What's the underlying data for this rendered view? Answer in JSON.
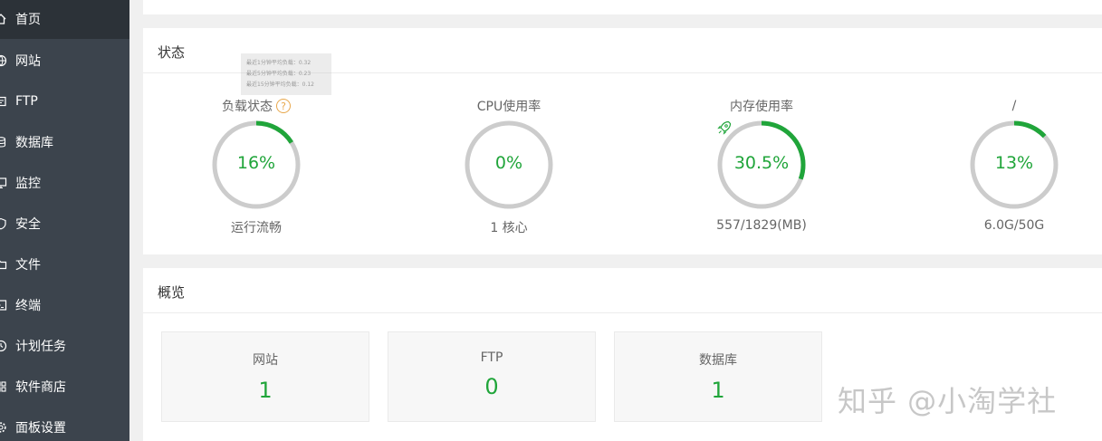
{
  "sidebar": {
    "items": [
      {
        "label": "首页",
        "icon": "home-icon"
      },
      {
        "label": "网站",
        "icon": "globe-icon"
      },
      {
        "label": "FTP",
        "icon": "ftp-icon"
      },
      {
        "label": "数据库",
        "icon": "database-icon"
      },
      {
        "label": "监控",
        "icon": "monitor-icon"
      },
      {
        "label": "安全",
        "icon": "shield-icon"
      },
      {
        "label": "文件",
        "icon": "folder-icon"
      },
      {
        "label": "终端",
        "icon": "terminal-icon"
      },
      {
        "label": "计划任务",
        "icon": "clock-icon"
      },
      {
        "label": "软件商店",
        "icon": "grid-icon"
      },
      {
        "label": "面板设置",
        "icon": "gear-icon"
      }
    ],
    "active_index": 0
  },
  "status": {
    "title": "状态",
    "tooltip": {
      "line1": "最近1分钟平均负载：0.32",
      "line2": "最近5分钟平均负载：0.23",
      "line3": "最近15分钟平均负载：0.12"
    },
    "gauges": [
      {
        "label": "负载状态",
        "value_text": "16%",
        "percent": 16,
        "footer": "运行流畅",
        "help": "?"
      },
      {
        "label": "CPU使用率",
        "value_text": "0%",
        "percent": 0,
        "footer": "1 核心"
      },
      {
        "label": "内存使用率",
        "value_text": "30.5%",
        "percent": 30.5,
        "footer": "557/1829(MB)"
      },
      {
        "label": "/",
        "value_text": "13%",
        "percent": 13,
        "footer": "6.0G/50G"
      }
    ],
    "colors": {
      "accent": "#20a53a",
      "track": "#cccccc",
      "help": "#e8a74b"
    }
  },
  "overview": {
    "title": "概览",
    "cards": [
      {
        "label": "网站",
        "value": "1"
      },
      {
        "label": "FTP",
        "value": "0"
      },
      {
        "label": "数据库",
        "value": "1"
      }
    ]
  },
  "watermark": "知乎 @小淘学社"
}
